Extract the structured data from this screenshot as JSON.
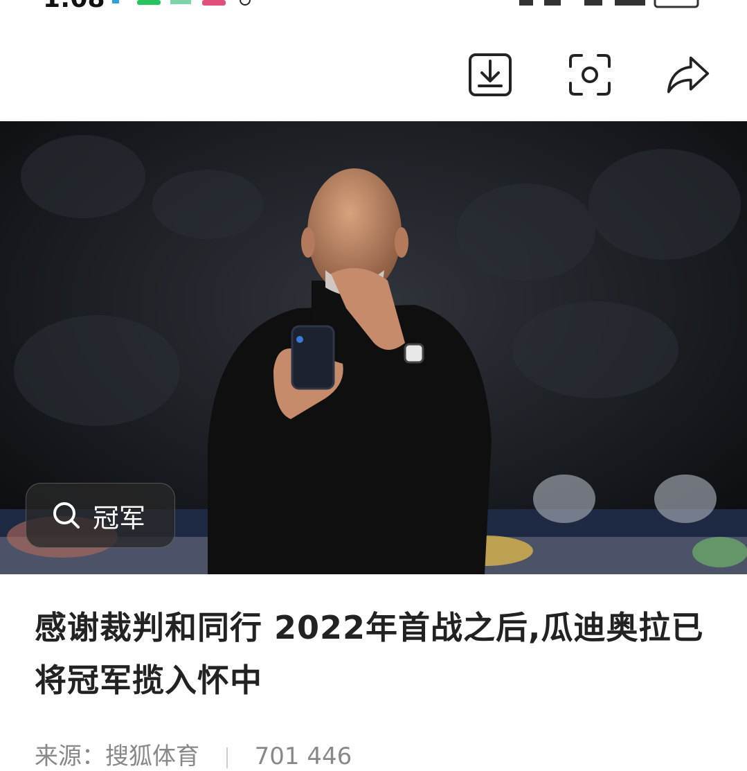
{
  "status_bar": {
    "time": "1:08"
  },
  "toolbar": {
    "download_icon": "download-icon",
    "screenshot_icon": "screenshot-icon",
    "share_icon": "share-icon"
  },
  "hero": {
    "search_chip": {
      "icon": "search-icon",
      "label": "冠军"
    }
  },
  "article": {
    "title": "感谢裁判和同行 2022年首战之后,瓜迪奥拉已将冠军揽入怀中",
    "source": "来源：搜狐体育",
    "meta_extra": "701 446"
  },
  "colors": {
    "hero_bg": "#15181d",
    "chip_bg": "#2a2a2a",
    "title_text": "#222222"
  }
}
